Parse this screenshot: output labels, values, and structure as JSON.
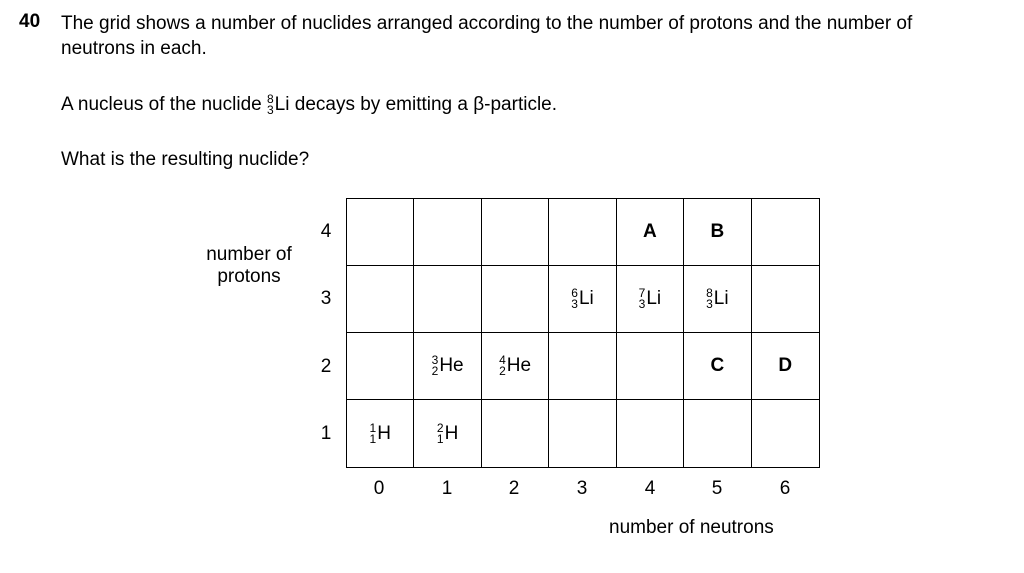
{
  "question": {
    "number": "40",
    "stem": "The grid shows a number of nuclides arranged according to the number of protons and the number of neutrons in each.",
    "para1": {
      "before": "A nucleus of the nuclide",
      "nuclide": {
        "mass": "8",
        "atomic": "3",
        "symbol": "Li"
      },
      "after": "decays by emitting a β-particle."
    },
    "para2": "What is the resulting nuclide?"
  },
  "grid": {
    "y_axis_label": "number of protons",
    "x_axis_label": "number of neutrons",
    "y_ticks": [
      "4",
      "3",
      "2",
      "1"
    ],
    "x_ticks": [
      "0",
      "1",
      "2",
      "3",
      "4",
      "5",
      "6"
    ],
    "cells": {
      "p4_n4": "A",
      "p4_n5": "B",
      "p3_n3": {
        "mass": "6",
        "atomic": "3",
        "symbol": "Li"
      },
      "p3_n4": {
        "mass": "7",
        "atomic": "3",
        "symbol": "Li"
      },
      "p3_n5": {
        "mass": "8",
        "atomic": "3",
        "symbol": "Li"
      },
      "p2_n1": {
        "mass": "3",
        "atomic": "2",
        "symbol": "He"
      },
      "p2_n2": {
        "mass": "4",
        "atomic": "2",
        "symbol": "He"
      },
      "p2_n5": "C",
      "p2_n6": "D",
      "p1_n0": {
        "mass": "1",
        "atomic": "1",
        "symbol": "H"
      },
      "p1_n1": {
        "mass": "2",
        "atomic": "1",
        "symbol": "H"
      }
    }
  }
}
